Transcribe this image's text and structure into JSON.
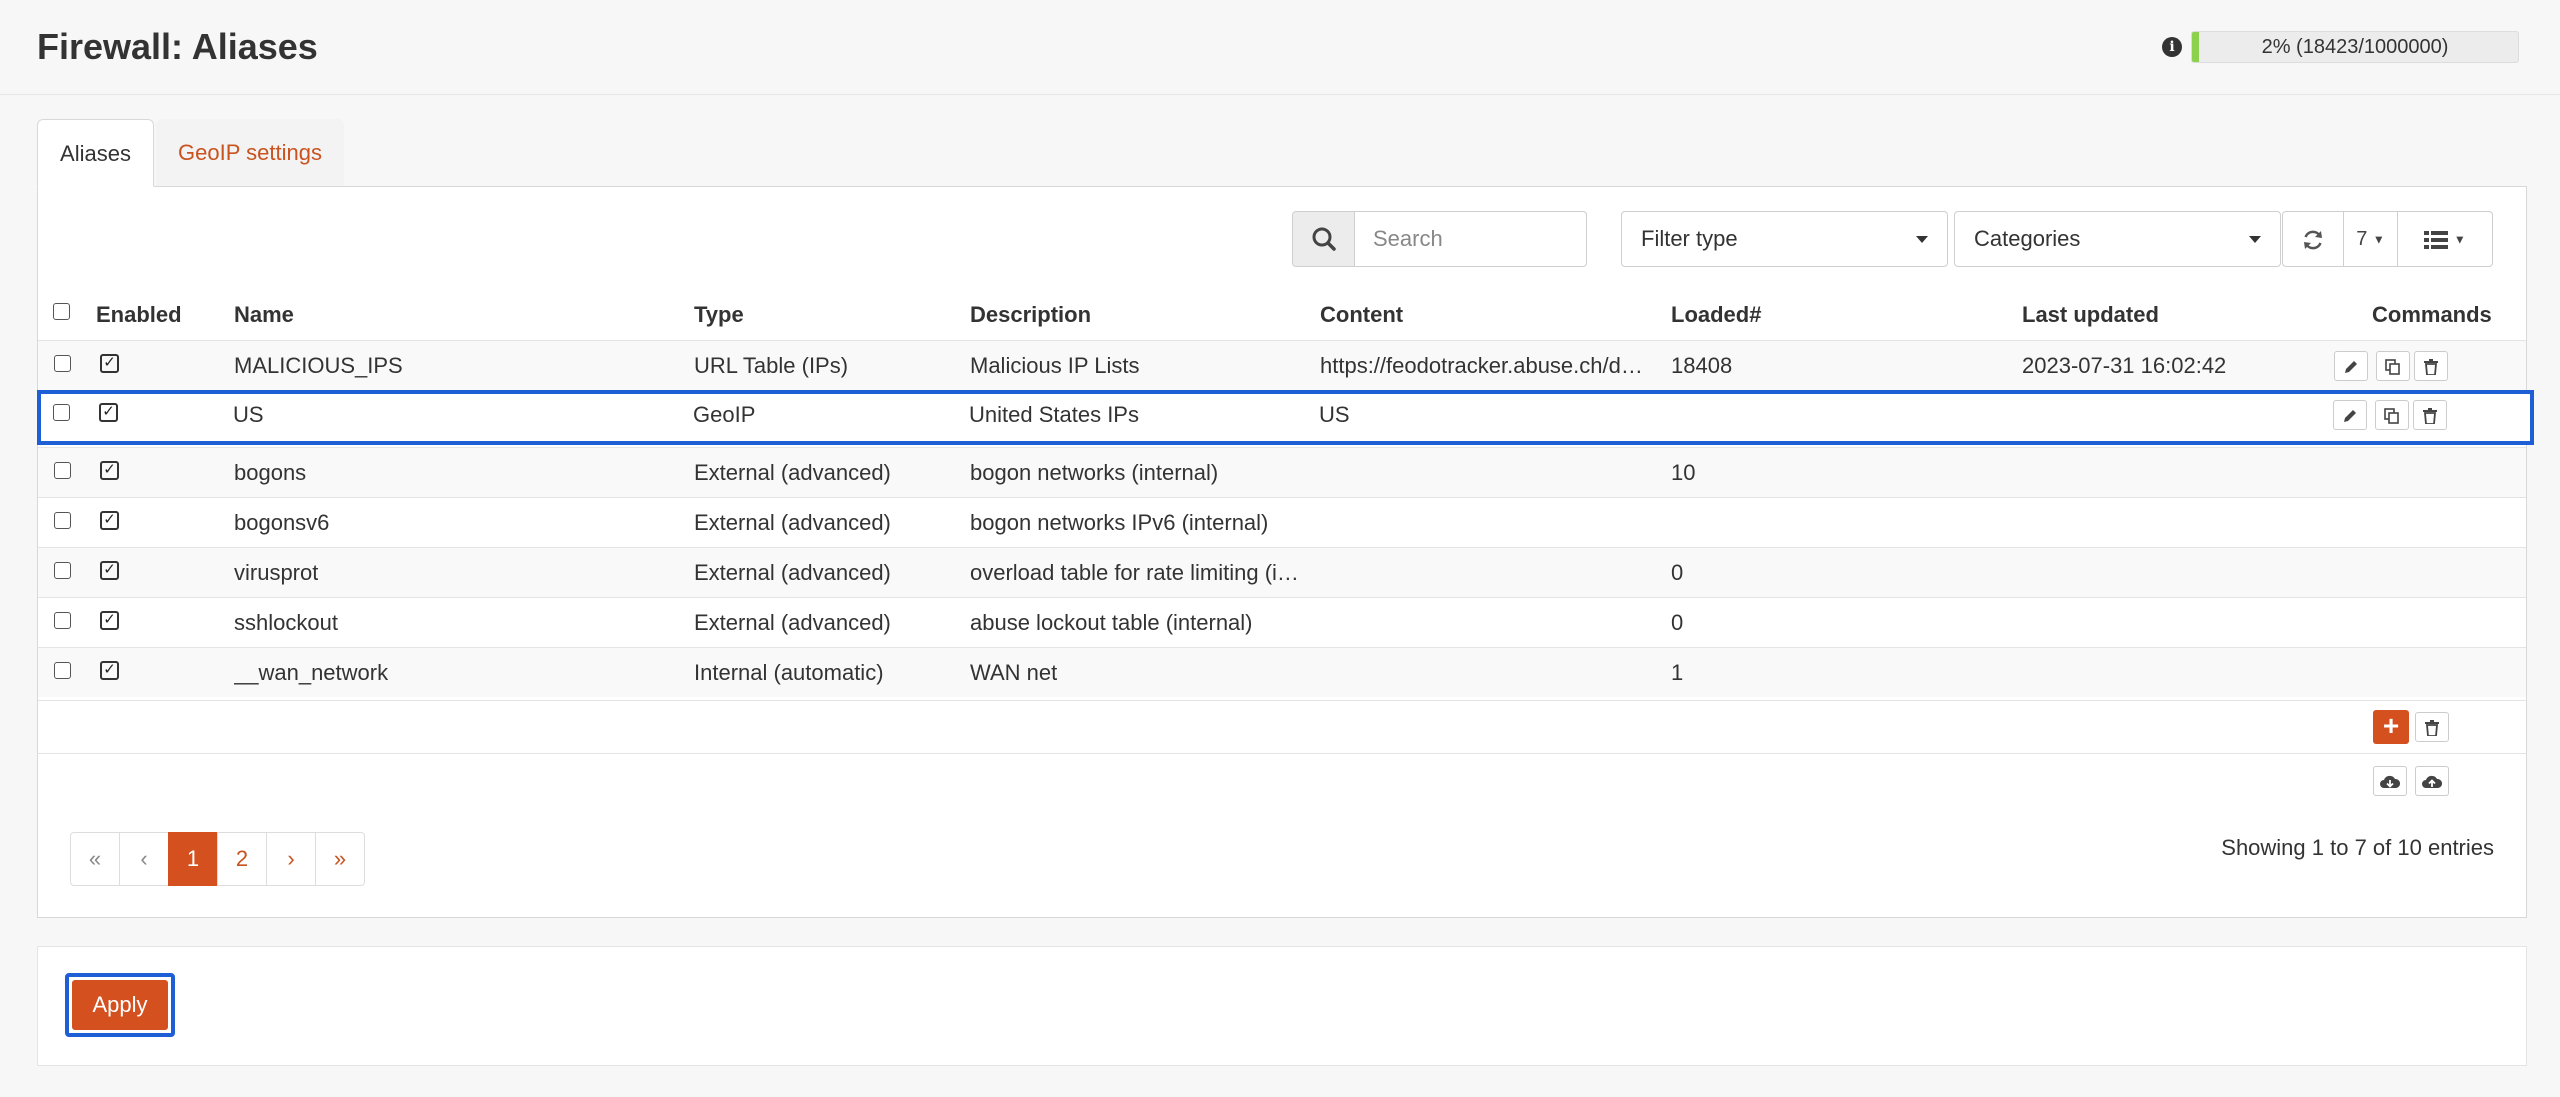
{
  "header": {
    "title": "Firewall: Aliases",
    "usage": {
      "text": "2% (18423/1000000)",
      "percent": 2,
      "bar_color": "#8bd14b"
    }
  },
  "tabs": [
    {
      "label": "Aliases",
      "active": true
    },
    {
      "label": "GeoIP settings",
      "active": false
    }
  ],
  "toolbar": {
    "search_placeholder": "Search",
    "filter_type": "Filter type",
    "categories": "Categories",
    "rows_per_page": "7"
  },
  "table": {
    "columns": [
      "Enabled",
      "Name",
      "Type",
      "Description",
      "Content",
      "Loaded#",
      "Last updated",
      "Commands"
    ],
    "rows": [
      {
        "name": "MALICIOUS_IPS",
        "type": "URL Table (IPs)",
        "description": "Malicious IP Lists",
        "content": "https://feodotracker.abuse.ch/d…",
        "loaded": "18408",
        "last_updated": "2023-07-31 16:02:42",
        "commands": true
      },
      {
        "name": "US",
        "type": "GeoIP",
        "description": "United States IPs",
        "content": "US",
        "loaded": "",
        "last_updated": "",
        "commands": true,
        "highlighted": true
      },
      {
        "name": "bogons",
        "type": "External (advanced)",
        "description": "bogon networks (internal)",
        "content": "",
        "loaded": "10",
        "last_updated": "",
        "commands": false
      },
      {
        "name": "bogonsv6",
        "type": "External (advanced)",
        "description": "bogon networks IPv6 (internal)",
        "content": "",
        "loaded": "",
        "last_updated": "",
        "commands": false
      },
      {
        "name": "virusprot",
        "type": "External (advanced)",
        "description": "overload table for rate limiting (i…",
        "content": "",
        "loaded": "0",
        "last_updated": "",
        "commands": false
      },
      {
        "name": "sshlockout",
        "type": "External (advanced)",
        "description": "abuse lockout table (internal)",
        "content": "",
        "loaded": "0",
        "last_updated": "",
        "commands": false
      },
      {
        "name": "__wan_network",
        "type": "Internal (automatic)",
        "description": "WAN net",
        "content": "",
        "loaded": "1",
        "last_updated": "",
        "commands": false
      }
    ]
  },
  "pagination": {
    "first": "«",
    "prev": "‹",
    "pages": [
      "1",
      "2"
    ],
    "current": "1",
    "next": "›",
    "last": "»",
    "summary": "Showing 1 to 7 of 10 entries"
  },
  "apply_label": "Apply",
  "icons": {
    "info": "info-icon",
    "search": "search-icon",
    "refresh": "refresh-icon",
    "columns": "list-columns-icon",
    "edit": "pencil-icon",
    "copy": "copy-icon",
    "delete": "trash-icon",
    "add": "plus-icon",
    "download": "cloud-download-icon",
    "upload": "cloud-upload-icon"
  },
  "colors": {
    "accent": "#d5501f",
    "highlight": "#1f5fd6"
  }
}
